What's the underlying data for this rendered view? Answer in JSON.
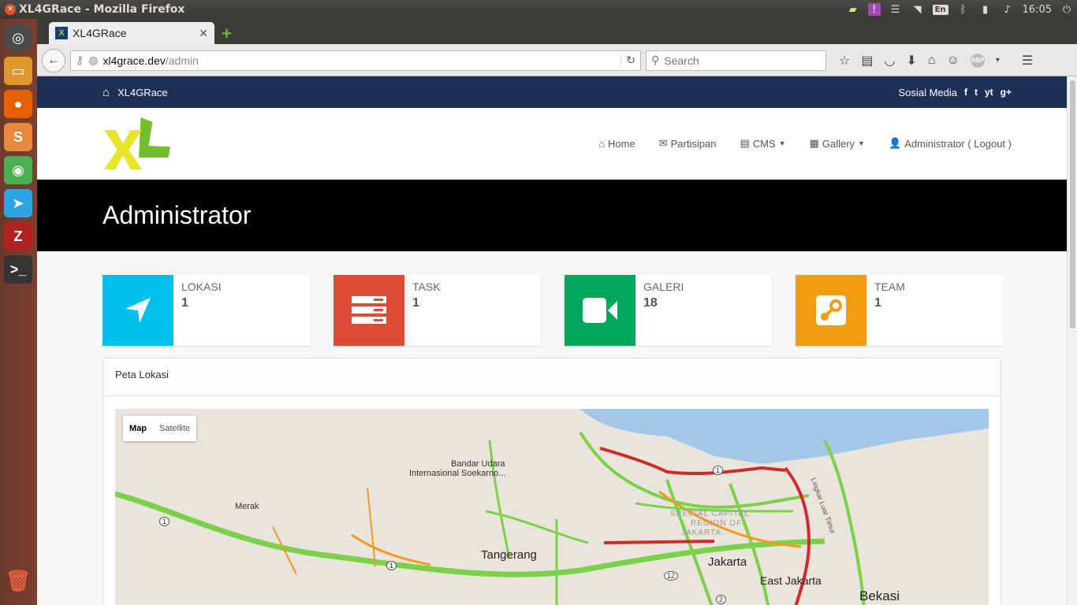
{
  "os": {
    "window_title": "XL4GRace - Mozilla Firefox",
    "lang": "En",
    "clock": "16:05"
  },
  "browser": {
    "tab_title": "XL4GRace",
    "url_host": "xl4grace.dev",
    "url_path": "/admin",
    "search_placeholder": "Search"
  },
  "site": {
    "brand": "XL4GRace",
    "social_label": "Sosial Media",
    "social_icons": [
      "f",
      "t",
      "yt",
      "g+"
    ],
    "nav": {
      "home": "Home",
      "participants": "Partisipan",
      "cms": "CMS",
      "gallery": "Gallery",
      "account": "Administrator ( Logout )"
    },
    "page_title": "Administrator",
    "stats": [
      {
        "label": "LOKASI",
        "value": "1",
        "color": "#00c0ef"
      },
      {
        "label": "TASK",
        "value": "1",
        "color": "#dd4b39"
      },
      {
        "label": "GALERI",
        "value": "18",
        "color": "#00a65a"
      },
      {
        "label": "TEAM",
        "value": "1",
        "color": "#f39c12"
      }
    ],
    "map_panel": {
      "title": "Peta Lokasi",
      "map_type_map": "Map",
      "map_type_satellite": "Satellite",
      "labels": {
        "airport_1": "Bandar Udara",
        "airport_2": "Internasional Soekarno...",
        "merak": "Merak",
        "tangerang": "Tangerang",
        "jakarta": "Jakarta",
        "east_jakarta": "East Jakarta",
        "bekasi": "Bekasi",
        "region_1": "SPECIAL CAPITAL",
        "region_2": "REGION OF",
        "region_3": "JAKARTA",
        "road_1": "1",
        "road_12": "12",
        "road_2": "2",
        "toll": "Lingkar Luar Timur"
      }
    }
  }
}
